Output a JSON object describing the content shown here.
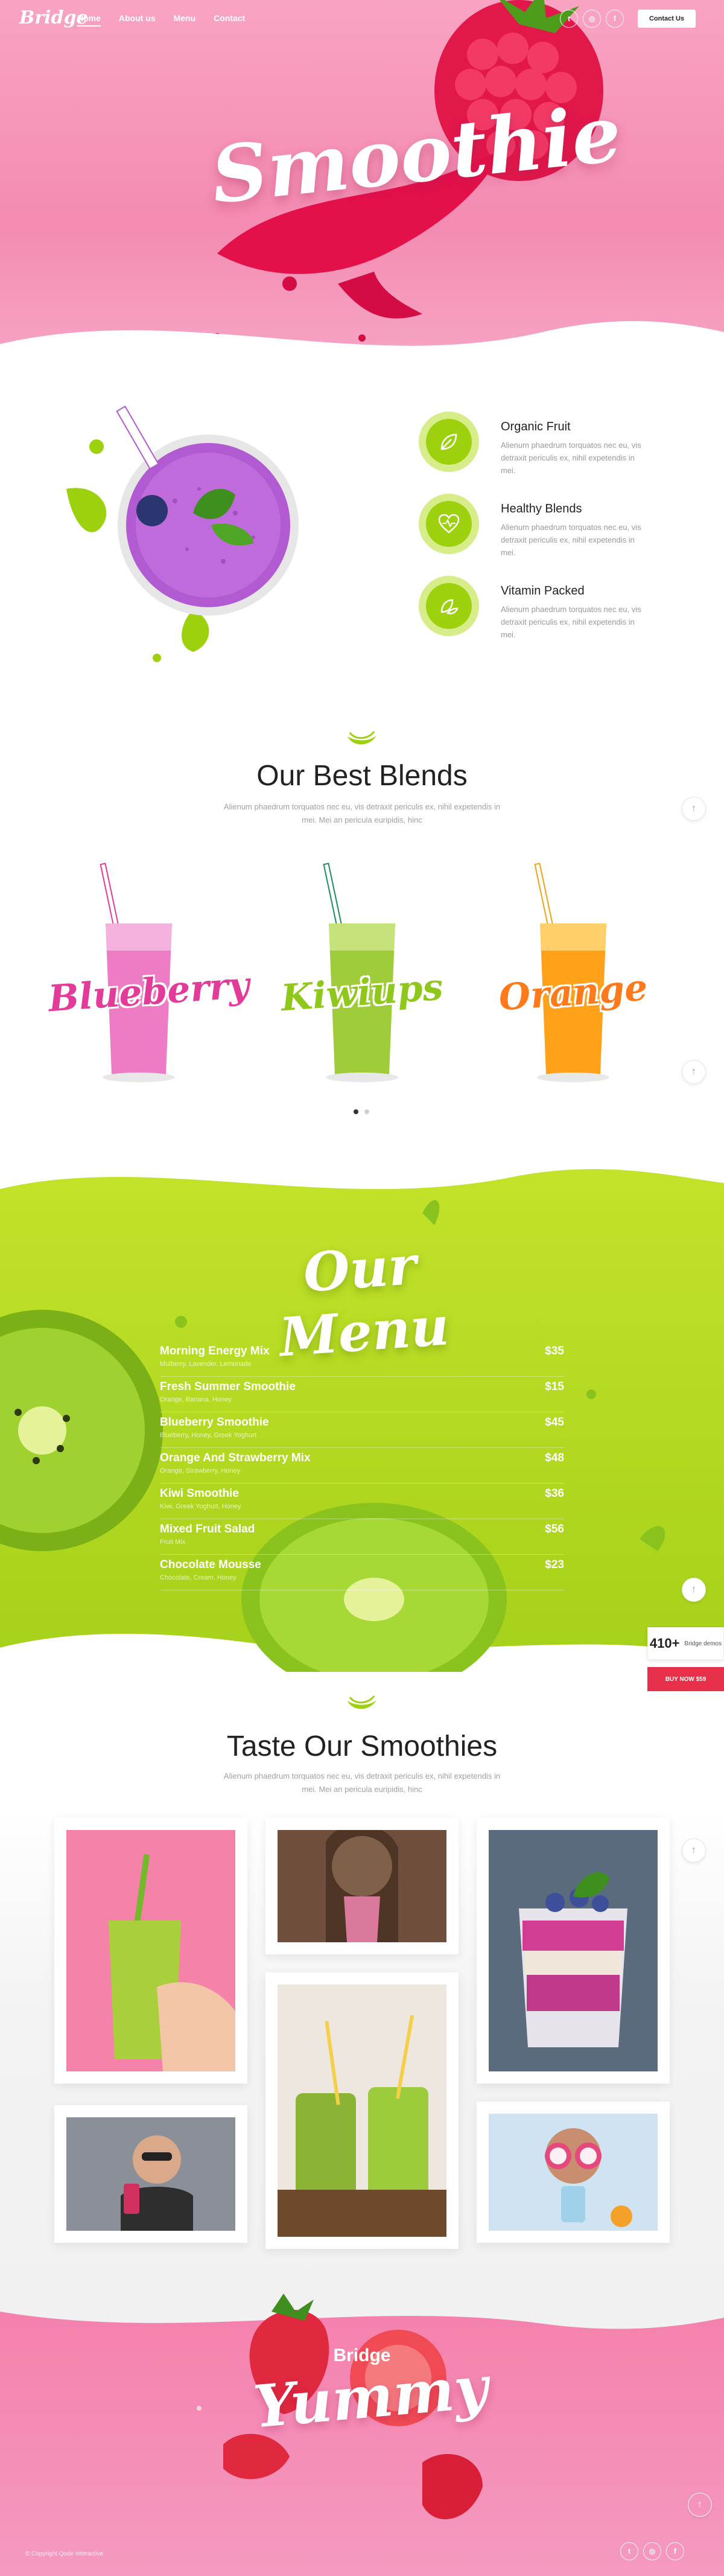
{
  "header": {
    "logo": "Bridge",
    "nav": [
      "Home",
      "About us",
      "Menu",
      "Contact"
    ],
    "social": [
      "twitter-icon",
      "instagram-icon",
      "facebook-icon"
    ],
    "contact_button": "Contact Us"
  },
  "hero": {
    "title": "Smoothie"
  },
  "features": [
    {
      "title": "Organic Fruit",
      "text": "Alienum phaedrum torquatos nec eu, vis detraxit periculis ex, nihil expetendis in mei."
    },
    {
      "title": "Healthy Blends",
      "text": "Alienum phaedrum torquatos nec eu, vis detraxit periculis ex, nihil expetendis in mei."
    },
    {
      "title": "Vitamin Packed",
      "text": "Alienum phaedrum torquatos nec eu, vis detraxit periculis ex, nihil expetendis in mei."
    }
  ],
  "blends": {
    "title": "Our Best Blends",
    "subtitle": "Alienum phaedrum torquatos nec eu, vis detraxit periculis ex, nihil expetendis in mei. Mei an pericula euripidis, hinc",
    "items": [
      "Blueberry",
      "Kiwiups",
      "Orange"
    ],
    "colors": [
      "#e33b9a",
      "#8fc81b",
      "#ff7a1a"
    ]
  },
  "menu": {
    "title": "Our Menu",
    "items": [
      {
        "name": "Morning Energy Mix",
        "desc": "Mulberry, Lavender, Lemonade",
        "price": "$35"
      },
      {
        "name": "Fresh Summer Smoothie",
        "desc": "Orange, Banana, Honey",
        "price": "$15"
      },
      {
        "name": "Blueberry Smoothie",
        "desc": "Blueberry, Honey, Greek Yoghurt",
        "price": "$45"
      },
      {
        "name": "Orange And Strawberry Mix",
        "desc": "Orange, Strawberry, Honey",
        "price": "$48"
      },
      {
        "name": "Kiwi Smoothie",
        "desc": "Kiwi, Greek Yoghurt, Honey",
        "price": "$36"
      },
      {
        "name": "Mixed Fruit Salad",
        "desc": "Fruit Mix",
        "price": "$56"
      },
      {
        "name": "Chocolate Mousse",
        "desc": "Chocolate, Cream, Honey",
        "price": "$23"
      }
    ]
  },
  "badges": {
    "demo_count": "410+",
    "demo_label": "Bridge demos",
    "buy_label": "BUY NOW $59"
  },
  "gallery": {
    "title": "Taste Our Smoothies",
    "subtitle": "Alienum phaedrum torquatos nec eu, vis detraxit periculis ex, nihil expetendis in mei. Mei an pericula euripidis, hinc"
  },
  "footer": {
    "brand": "Bridge",
    "title": "Yummy",
    "copyright": "© Copyright Qode Interactive",
    "social": [
      "twitter-icon",
      "instagram-icon",
      "facebook-icon"
    ]
  }
}
